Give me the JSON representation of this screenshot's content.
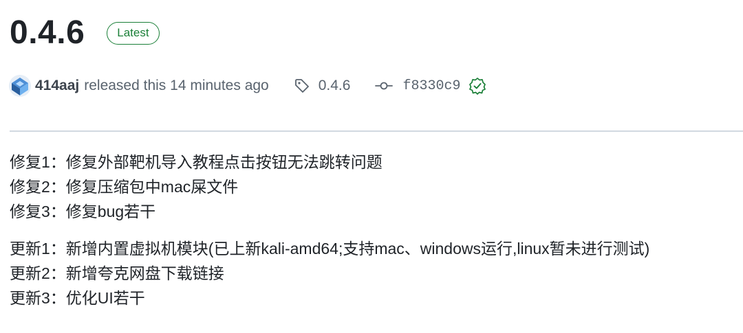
{
  "release": {
    "version": "0.4.6",
    "badge": "Latest",
    "author": "414aaj",
    "released_text": "released this 14 minutes ago",
    "tag": "0.4.6",
    "commit": "f8330c9"
  },
  "notes": {
    "fixes": [
      "修复1：修复外部靶机导入教程点击按钮无法跳转问题",
      "修复2：修复压缩包中mac屎文件",
      "修复3：修复bug若干"
    ],
    "updates": [
      "更新1：新增内置虚拟机模块(已上新kali-amd64;支持mac、windows运行,linux暂未进行测试)",
      "更新2：新增夸克网盘下载链接",
      "更新3：优化UI若干"
    ]
  },
  "colors": {
    "badge_green": "#1a7f37",
    "muted_text": "#59636e",
    "divider": "#d1d9e0"
  },
  "icons": {
    "tag": "tag-icon",
    "commit": "git-commit-icon",
    "verified": "verified-check-icon",
    "avatar": "user-avatar"
  }
}
